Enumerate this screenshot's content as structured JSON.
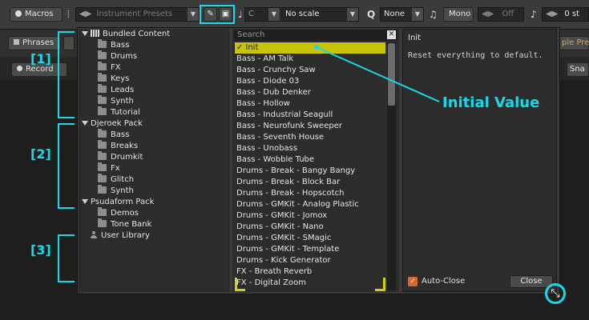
{
  "toolbar": {
    "macros_label": "Macros",
    "preset_placeholder": "Instrument Presets",
    "key_value": "C",
    "scale_value": "No scale",
    "quantize_label": "Q",
    "quantize_value": "None",
    "mono_label": "Mono",
    "glide_value": "Off",
    "transpose_value": "0 st"
  },
  "row2": {
    "phrases_tab": "Phrases",
    "sample_tab": "ple Pre"
  },
  "row3": {
    "record_label": "Record",
    "snap_label": "Sna"
  },
  "tree": {
    "groups": [
      {
        "title": "Bundled Content",
        "items": [
          "Bass",
          "Drums",
          "FX",
          "Keys",
          "Leads",
          "Synth",
          "Tutorial"
        ]
      },
      {
        "title": "Djeroek Pack",
        "items": [
          "Bass",
          "Breaks",
          "Drumkit",
          "Fx",
          "Glitch",
          "Synth"
        ]
      },
      {
        "title": "Psudaform Pack",
        "items": [
          "Demos",
          "Tone Bank"
        ]
      },
      {
        "title": "User Library",
        "items": []
      }
    ]
  },
  "list": {
    "search_placeholder": "Search",
    "selected_check": "✓",
    "items": [
      "Init",
      "Bass - AM Talk",
      "Bass - Crunchy Saw",
      "Bass - Diode 03",
      "Bass - Dub Denker",
      "Bass - Hollow",
      "Bass - Industrial Seagull",
      "Bass - Neurofunk Sweeper",
      "Bass - Seventh House",
      "Bass - Unobass",
      "Bass - Wobble Tube",
      "Drums - Break - Bangy Bangy",
      "Drums - Break - Block Bar",
      "Drums - Break - Hopscotch",
      "Drums - GMKit - Analog Plastic",
      "Drums - GMKit - Jomox",
      "Drums - GMKit - Nano",
      "Drums - GMKit - SMagic",
      "Drums - GMKit - Template",
      "Drums - Kick Generator",
      "FX - Breath Reverb",
      "FX - Digital Zoom"
    ]
  },
  "info": {
    "title": "Init",
    "description": "Reset everything to default.",
    "autoclose_label": "Auto-Close",
    "autoclose_checked": true,
    "close_label": "Close"
  },
  "annotations": {
    "label1": "[1]",
    "label2": "[2]",
    "label3": "[3]",
    "initial_value": "Initial Value",
    "color": "#19d9e8"
  },
  "colors": {
    "selection": "#c9c40a",
    "checkbox": "#d8692a"
  }
}
